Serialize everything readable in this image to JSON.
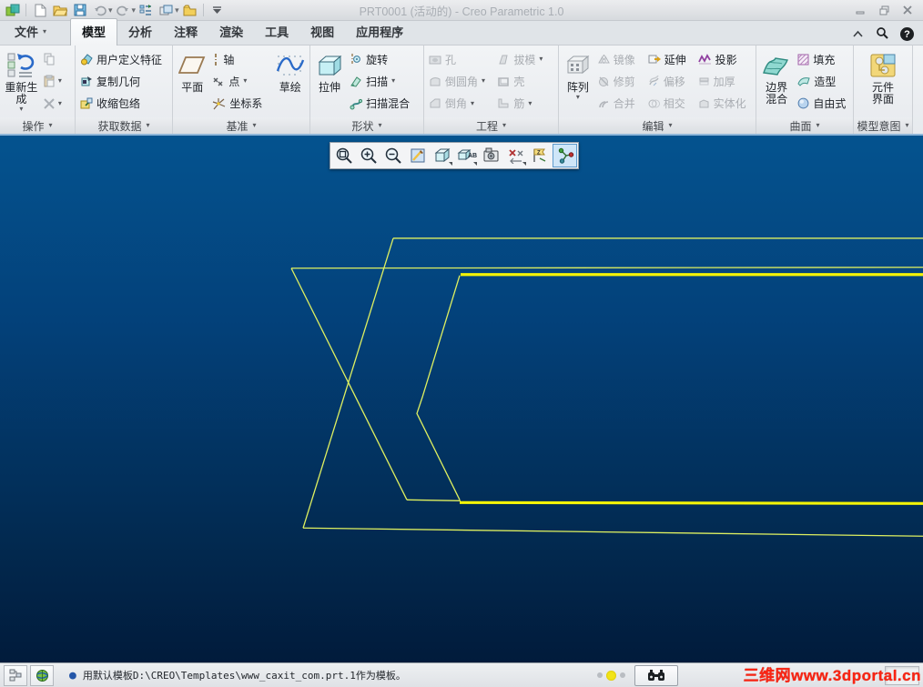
{
  "window": {
    "title": "PRT0001 (活动的) - Creo Parametric 1.0"
  },
  "tabs": {
    "file": "文件",
    "model": "模型",
    "analysis": "分析",
    "annotate": "注释",
    "render": "渲染",
    "tools": "工具",
    "view": "视图",
    "applications": "应用程序",
    "active": "模型"
  },
  "ribbon": {
    "operate": {
      "label": "操作",
      "regenerate": "重新生成"
    },
    "get_data": {
      "label": "获取数据",
      "udf": "用户定义特征",
      "copy_geometry": "复制几何",
      "shrinkwrap": "收缩包络"
    },
    "datum": {
      "label": "基准",
      "plane": "平面",
      "axis": "轴",
      "point": "点",
      "csys": "坐标系",
      "sketch": "草绘"
    },
    "shapes": {
      "label": "形状",
      "extrude": "拉伸",
      "revolve": "旋转",
      "sweep": "扫描",
      "swept_blend": "扫描混合"
    },
    "engineering": {
      "label": "工程",
      "hole": "孔",
      "round": "倒圆角",
      "chamfer": "倒角",
      "draft": "拔模",
      "shell": "壳",
      "rib": "筋"
    },
    "editing": {
      "label": "编辑",
      "pattern": "阵列",
      "mirror": "镜像",
      "trim": "修剪",
      "merge": "合并",
      "extend": "延伸",
      "offset": "偏移",
      "intersect": "相交",
      "project": "投影",
      "thicken": "加厚",
      "solidify": "实体化"
    },
    "surfaces": {
      "label": "曲面",
      "boundary_blend": "边界混合",
      "fill": "填充",
      "style": "造型",
      "freestyle": "自由式"
    },
    "model_intent": {
      "label": "模型意图",
      "component_interface": "元件界面"
    }
  },
  "icons": {
    "quick_access": [
      "app-logo",
      "new-file",
      "open-file",
      "save-file",
      "undo",
      "redo",
      "regenerate-small",
      "window-switch",
      "close-window",
      "customize-toolbar"
    ],
    "window_controls": [
      "minimize",
      "restore",
      "close"
    ],
    "tab_utils": [
      "collapse-ribbon",
      "command-search",
      "help"
    ],
    "graphics_toolbar": [
      "refit",
      "zoom-in",
      "zoom-out",
      "repaint",
      "display-style",
      "saved-orientations",
      "view-manager",
      "datum-display-filters",
      "annotation-display",
      "spin-center"
    ],
    "status": [
      "model-tree-toggle",
      "web-browser-toggle",
      "message-log-dots",
      "find-binoculars"
    ]
  },
  "graphics_toolbar": {
    "active_button": "spin-center"
  },
  "status_bar": {
    "message": "用默认模板D:\\CREO\\Templates\\www_caxit_com.prt.1作为模板。",
    "watermark": "三维网www.3dportal.cn"
  },
  "geometry": {
    "background_top": "#04538f",
    "background_bottom": "#011b3b",
    "thin_color": "#dff060",
    "thick_color": "#f4f407",
    "thin_lines": [
      [
        [
          432,
          113
        ],
        [
          1014,
          113
        ]
      ],
      [
        [
          432,
          113
        ],
        [
          333,
          432
        ]
      ],
      [
        [
          320,
          146
        ],
        [
          1014,
          145
        ]
      ],
      [
        [
          320,
          146
        ],
        [
          447,
          401
        ]
      ],
      [
        [
          447,
          401
        ],
        [
          506,
          402
        ]
      ],
      [
        [
          333,
          432
        ],
        [
          1014,
          441
        ]
      ],
      [
        [
          505,
          154
        ],
        [
          464,
          288
        ],
        [
          458,
          306
        ],
        [
          505,
          401
        ]
      ]
    ],
    "thick_lines": [
      [
        [
          506,
          153
        ],
        [
          1014,
          153
        ]
      ],
      [
        [
          505,
          404
        ],
        [
          1014,
          405
        ]
      ]
    ]
  }
}
